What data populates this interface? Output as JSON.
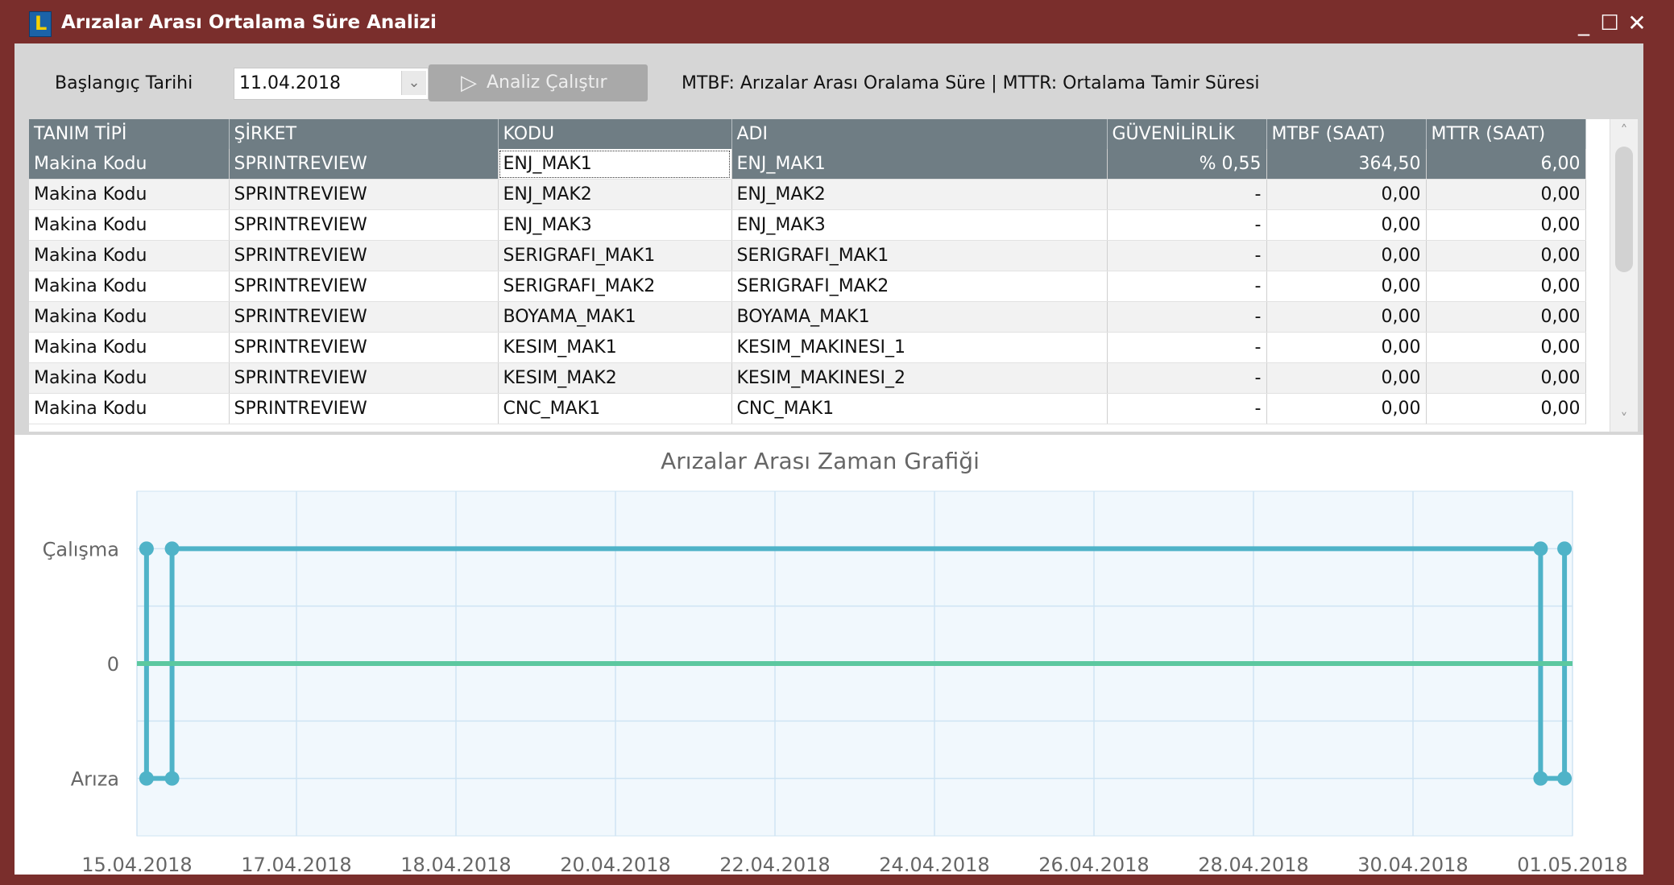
{
  "window": {
    "title": "Arızalar Arası Ortalama Süre Analizi",
    "logo_letter": "L",
    "controls": {
      "minimize": "_",
      "maximize": "☐",
      "close": "✕"
    }
  },
  "toolbar": {
    "start_date_label": "Başlangıç Tarihi",
    "start_date_value": "11.04.2018",
    "dropdown_icon": "⌄",
    "run_button_icon": "▷",
    "run_button_label": "Analiz Çalıştır",
    "legend_text": "MTBF: Arızalar Arası Oralama Süre  |  MTTR: Ortalama Tamir Süresi"
  },
  "table": {
    "columns": [
      "TANIM TİPİ",
      "ŞİRKET",
      "KODU",
      "ADI",
      "GÜVENİLİRLİK",
      "MTBF (SAAT)",
      "MTTR (SAAT)"
    ],
    "rows": [
      [
        "Makina Kodu",
        "SPRINTREVIEW",
        "ENJ_MAK1",
        "ENJ_MAK1",
        "% 0,55",
        "364,50",
        "6,00"
      ],
      [
        "Makina Kodu",
        "SPRINTREVIEW",
        "ENJ_MAK2",
        "ENJ_MAK2",
        "-",
        "0,00",
        "0,00"
      ],
      [
        "Makina Kodu",
        "SPRINTREVIEW",
        "ENJ_MAK3",
        "ENJ_MAK3",
        "-",
        "0,00",
        "0,00"
      ],
      [
        "Makina Kodu",
        "SPRINTREVIEW",
        "SERIGRAFI_MAK1",
        "SERIGRAFI_MAK1",
        "-",
        "0,00",
        "0,00"
      ],
      [
        "Makina Kodu",
        "SPRINTREVIEW",
        "SERIGRAFI_MAK2",
        "SERIGRAFI_MAK2",
        "-",
        "0,00",
        "0,00"
      ],
      [
        "Makina Kodu",
        "SPRINTREVIEW",
        "BOYAMA_MAK1",
        "BOYAMA_MAK1",
        "-",
        "0,00",
        "0,00"
      ],
      [
        "Makina Kodu",
        "SPRINTREVIEW",
        "KESIM_MAK1",
        "KESIM_MAKINESI_1",
        "-",
        "0,00",
        "0,00"
      ],
      [
        "Makina Kodu",
        "SPRINTREVIEW",
        "KESIM_MAK2",
        "KESIM_MAKINESI_2",
        "-",
        "0,00",
        "0,00"
      ],
      [
        "Makina Kodu",
        "SPRINTREVIEW",
        "CNC_MAK1",
        "CNC_MAK1",
        "-",
        "0,00",
        "0,00"
      ]
    ],
    "selected_row": 0,
    "scroll_up_icon": "˄",
    "scroll_down_icon": "˅"
  },
  "chart_data": {
    "type": "line",
    "title": "Arızalar Arası Zaman Grafiği",
    "x_ticks": [
      "15.04.2018",
      "17.04.2018",
      "18.04.2018",
      "20.04.2018",
      "22.04.2018",
      "24.04.2018",
      "26.04.2018",
      "28.04.2018",
      "30.04.2018",
      "01.05.2018"
    ],
    "y_ticks": [
      "Çalışma",
      "0",
      "Arıza"
    ],
    "y_values": {
      "Çalışma": 1,
      "0": 0,
      "Arıza": -1
    },
    "ylim": [
      -1.5,
      1.5
    ],
    "series": [
      {
        "color": "#4fb3c8",
        "x": [
          0.06,
          0.06,
          0.22,
          0.22,
          8.8,
          8.8,
          8.95,
          8.95
        ],
        "y": [
          1,
          -1,
          -1,
          1,
          1,
          -1,
          -1,
          1
        ]
      },
      {
        "color": "#5cc8a0",
        "x": [
          0,
          9
        ],
        "y": [
          0,
          0
        ]
      }
    ],
    "grid": true,
    "plot_background": "#f1f8fd",
    "grid_color": "#cfe4f3"
  }
}
